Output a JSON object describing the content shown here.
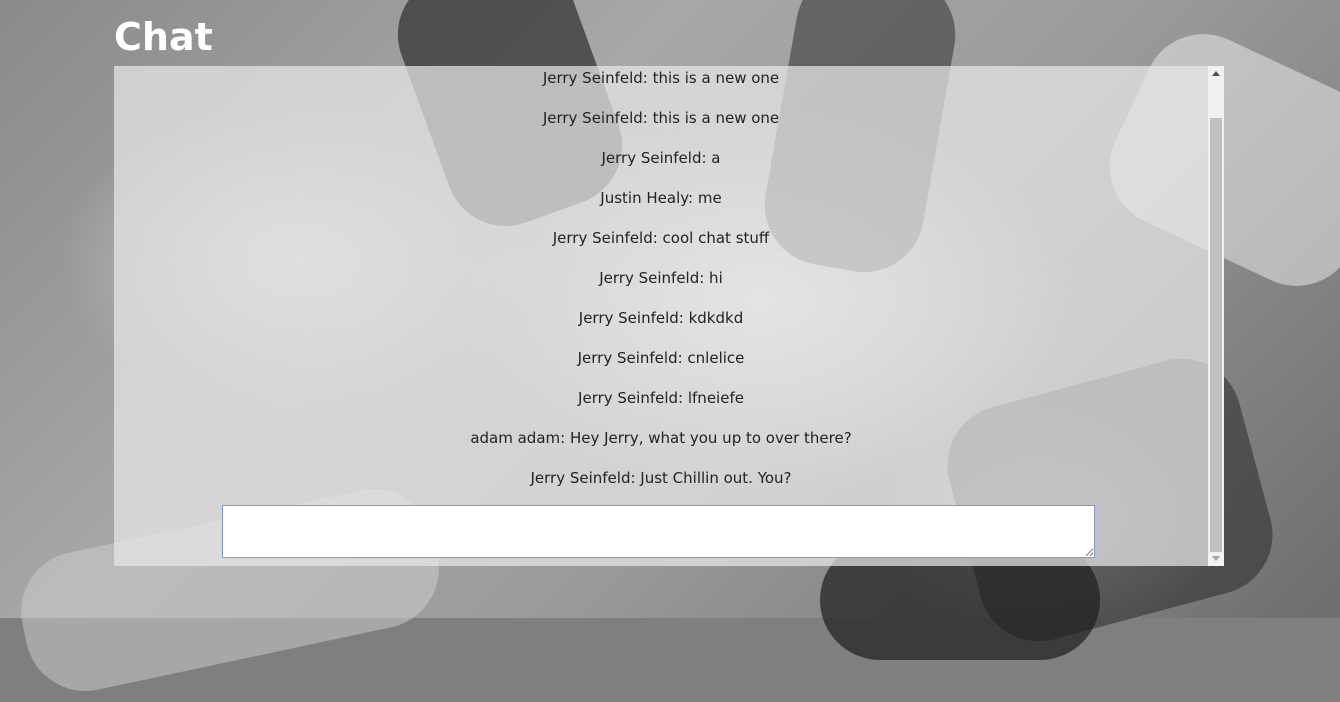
{
  "page": {
    "title": "Chat"
  },
  "chat": {
    "messages": [
      "Jerry Seinfeld: this is a new one",
      "Jerry Seinfeld: this is a new one",
      "Jerry Seinfeld: a",
      "Justin Healy: me",
      "Jerry Seinfeld: cool chat stuff",
      "Jerry Seinfeld: hi",
      "Jerry Seinfeld: kdkdkd",
      "Jerry Seinfeld: cnlelice",
      "Jerry Seinfeld: lfneiefe",
      "adam adam: Hey Jerry, what you up to over there?",
      "Jerry Seinfeld: Just Chillin out. You?"
    ],
    "input": {
      "value": "",
      "placeholder": ""
    }
  },
  "colors": {
    "panel": "#e8e8e8",
    "input_border": "#7a9ad0",
    "title": "#ffffff"
  }
}
